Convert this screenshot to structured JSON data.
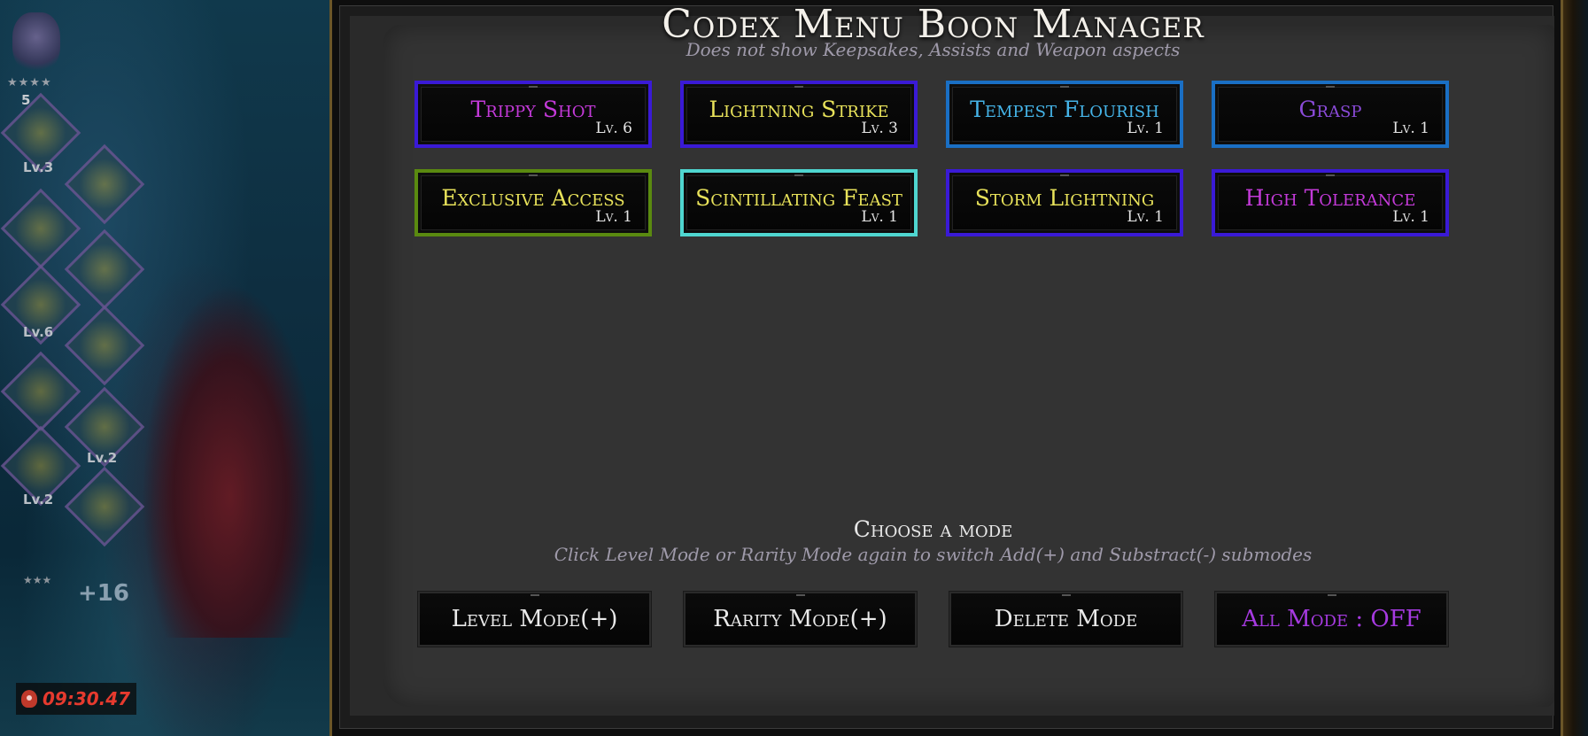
{
  "game": {
    "charge": "5",
    "boon_levels": [
      "Lv.3",
      "Lv.6",
      "Lv.2",
      "Lv.2"
    ],
    "plus_count": "+16",
    "stars_top": "★★★★",
    "stars_bottom": "★★★",
    "timer": "09:30.47",
    "timer_color": "#e63a2e"
  },
  "panel": {
    "title": "Codex Menu Boon Manager",
    "subtitle": "Does not show Keepsakes, Assists and Weapon aspects"
  },
  "boons": [
    {
      "name": "Trippy Shot",
      "level": "Lv. 6",
      "name_color": "#c43ad9",
      "border_color": "#3a1ad6"
    },
    {
      "name": "Lightning Strike",
      "level": "Lv. 3",
      "name_color": "#e8e25a",
      "border_color": "#3a1ad6"
    },
    {
      "name": "Tempest Flourish",
      "level": "Lv. 1",
      "name_color": "#45b4e8",
      "border_color": "#1a6fc4"
    },
    {
      "name": "Grasp",
      "level": "Lv. 1",
      "name_color": "#8a4ad8",
      "border_color": "#1a6fc4"
    },
    {
      "name": "Exclusive Access",
      "level": "Lv. 1",
      "name_color": "#e8e25a",
      "border_color": "#5a8a10"
    },
    {
      "name": "Scintillating Feast",
      "level": "Lv. 1",
      "name_color": "#e8e25a",
      "border_color": "#4fd6d0"
    },
    {
      "name": "Storm Lightning",
      "level": "Lv. 1",
      "name_color": "#e8e25a",
      "border_color": "#3a1ad6"
    },
    {
      "name": "High Tolerance",
      "level": "Lv. 1",
      "name_color": "#c43ad9",
      "border_color": "#3a1ad6"
    }
  ],
  "modes": {
    "title": "Choose a mode",
    "hint": "Click Level Mode or Rarity Mode again to switch Add(+) and Substract(-) submodes",
    "buttons": [
      {
        "label": "Level Mode(+)",
        "color": "#eaeaea"
      },
      {
        "label": "Rarity Mode(+)",
        "color": "#eaeaea"
      },
      {
        "label": "Delete Mode",
        "color": "#eaeaea"
      },
      {
        "label": "All Mode : OFF",
        "color": "#a63ae0"
      }
    ]
  }
}
